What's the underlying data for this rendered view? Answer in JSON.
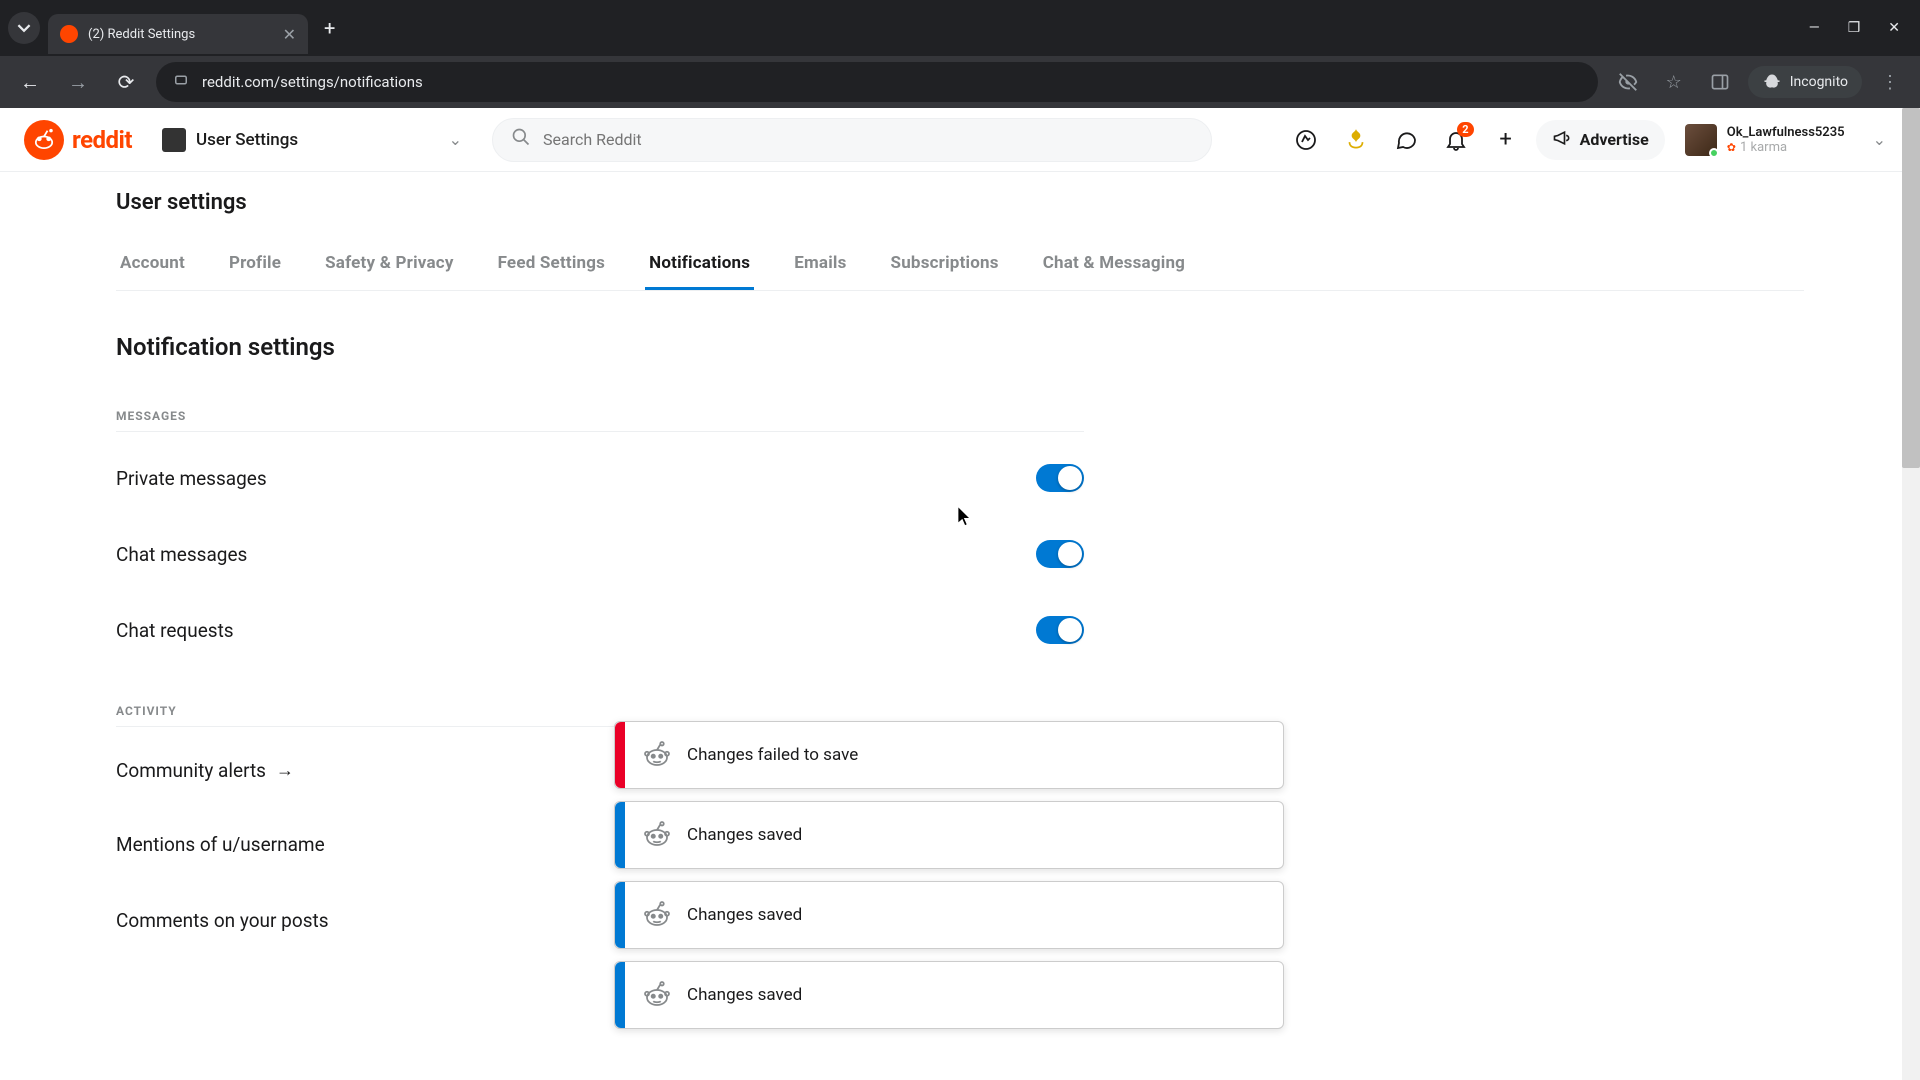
{
  "browser": {
    "tab_title": "(2) Reddit Settings",
    "url": "reddit.com/settings/notifications",
    "incognito_label": "Incognito"
  },
  "header": {
    "logo_text": "reddit",
    "nav_label": "User Settings",
    "search_placeholder": "Search Reddit",
    "notif_count": "2",
    "advertise_label": "Advertise",
    "username": "Ok_Lawfulness5235",
    "karma_text": "1 karma"
  },
  "page": {
    "title": "User settings",
    "tabs": [
      {
        "label": "Account"
      },
      {
        "label": "Profile"
      },
      {
        "label": "Safety & Privacy"
      },
      {
        "label": "Feed Settings"
      },
      {
        "label": "Notifications",
        "active": true
      },
      {
        "label": "Emails"
      },
      {
        "label": "Subscriptions"
      },
      {
        "label": "Chat & Messaging"
      }
    ],
    "section_title": "Notification settings",
    "groups": [
      {
        "label": "MESSAGES",
        "rows": [
          {
            "label": "Private messages",
            "on": true
          },
          {
            "label": "Chat messages",
            "on": true
          },
          {
            "label": "Chat requests",
            "on": true
          }
        ]
      },
      {
        "label": "ACTIVITY",
        "rows": [
          {
            "label": "Community alerts",
            "link": true
          },
          {
            "label": "Mentions of u/username",
            "on": true
          },
          {
            "label": "Comments on your posts",
            "on": true
          }
        ]
      }
    ]
  },
  "toasts": [
    {
      "type": "error",
      "msg": "Changes failed to save"
    },
    {
      "type": "success",
      "msg": "Changes saved"
    },
    {
      "type": "success",
      "msg": "Changes saved"
    },
    {
      "type": "success",
      "msg": "Changes saved"
    }
  ]
}
